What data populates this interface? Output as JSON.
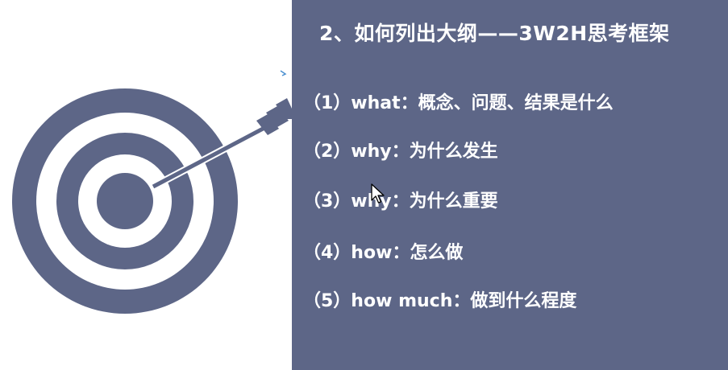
{
  "slide": {
    "title": "2、如何列出大纲——3W2H思考框架",
    "items": [
      {
        "label": "（1）what：概念、问题、结果是什么"
      },
      {
        "label": "（2）why：为什么发生"
      },
      {
        "label": "（3）why：为什么重要"
      },
      {
        "label": "（4）how：怎么做"
      },
      {
        "label": "（5）how much：做到什么程度"
      }
    ]
  },
  "colors": {
    "panel_bg": "#5d6687",
    "target": "#5d6687",
    "text": "#ffffff"
  },
  "icons": {
    "target": "target-with-arrow-icon",
    "cursor": "mouse-pointer-icon"
  }
}
